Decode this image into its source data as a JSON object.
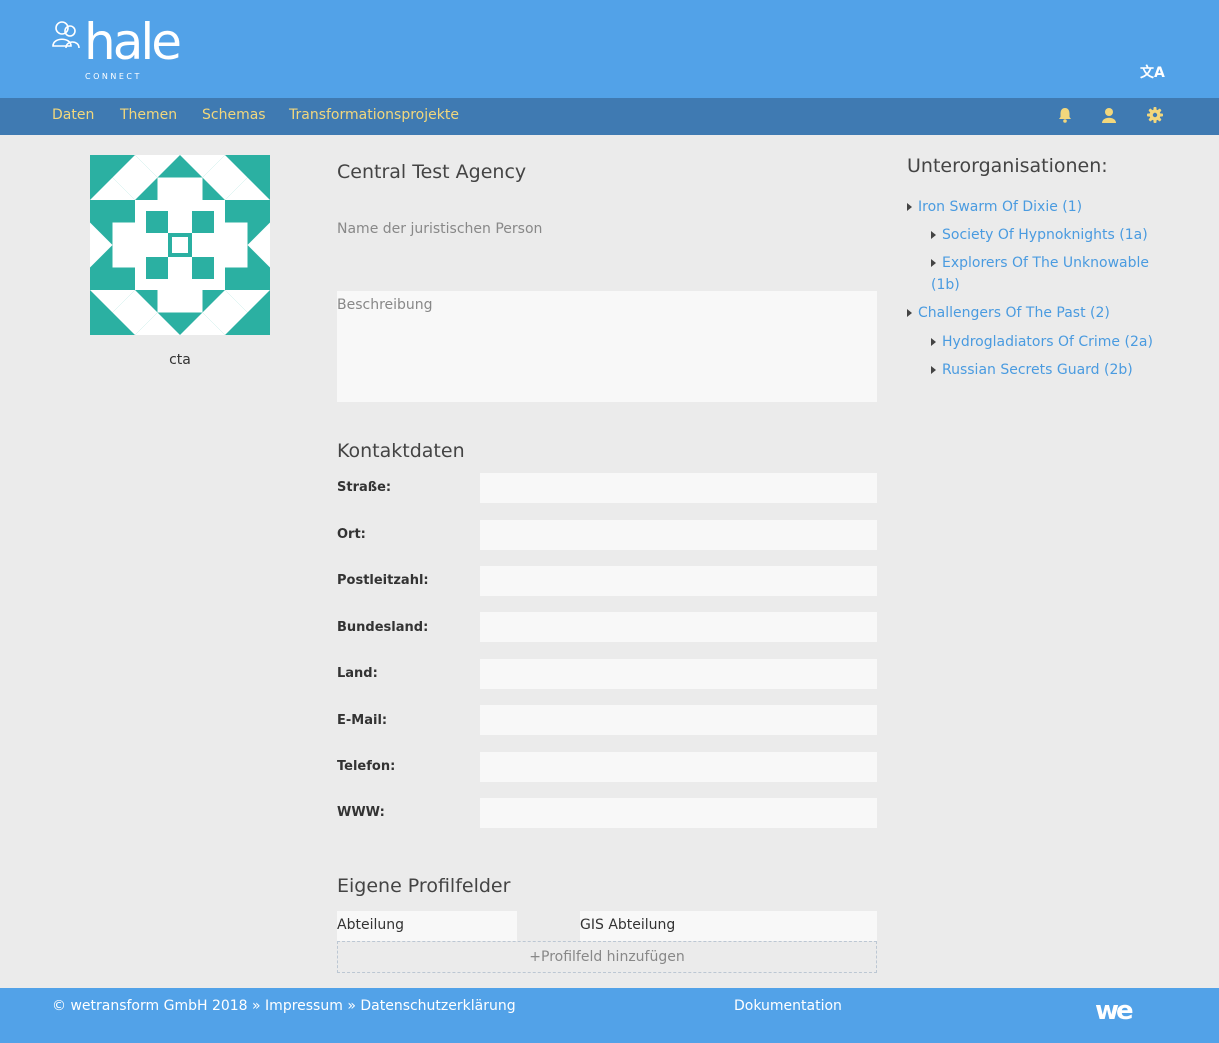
{
  "header": {
    "logo_word": "hale",
    "logo_sub": "CONNECT",
    "translate_icon": "文A"
  },
  "nav": {
    "items": [
      "Daten",
      "Themen",
      "Schemas",
      "Transformationsprojekte"
    ],
    "icons": [
      "bell-icon",
      "user-icon",
      "gear-icon"
    ],
    "accent_color": "#f2d77c"
  },
  "profile": {
    "avatar_color": "#2bb0a2",
    "short_name": "cta"
  },
  "organization": {
    "name": "Central Test Agency",
    "legal_name_placeholder": "Name der juristischen Person",
    "description_placeholder": "Beschreibung"
  },
  "contact": {
    "title": "Kontaktdaten",
    "fields": [
      {
        "label": "Straße:",
        "value": ""
      },
      {
        "label": "Ort:",
        "value": ""
      },
      {
        "label": "Postleitzahl:",
        "value": ""
      },
      {
        "label": "Bundesland:",
        "value": ""
      },
      {
        "label": "Land:",
        "value": ""
      },
      {
        "label": "E-Mail:",
        "value": ""
      },
      {
        "label": "Telefon:",
        "value": ""
      },
      {
        "label": "WWW:",
        "value": ""
      }
    ]
  },
  "custom_fields": {
    "title": "Eigene Profilfelder",
    "items": [
      {
        "label": "Abteilung",
        "value": "GIS Abteilung"
      }
    ],
    "add_label": "+Profilfeld hinzufügen"
  },
  "suborganizations": {
    "title": "Unterorganisationen:",
    "items": [
      {
        "label": "Iron Swarm Of Dixie (1)"
      },
      {
        "label": "Society Of Hypnoknights (1a)"
      },
      {
        "label": "Explorers Of The Unknowable"
      },
      {
        "label": "(1b)"
      },
      {
        "label": "Challengers Of The Past (2)"
      },
      {
        "label": "Hydrogladiators Of Crime (2a)"
      },
      {
        "label": "Russian Secrets Guard (2b)"
      }
    ]
  },
  "footer": {
    "copyright": "© wetransform GmbH 2018 »",
    "impressum": "Impressum",
    "sep": "»",
    "privacy": "Datenschutzerklärung",
    "docs": "Dokumentation",
    "logo": "we"
  }
}
